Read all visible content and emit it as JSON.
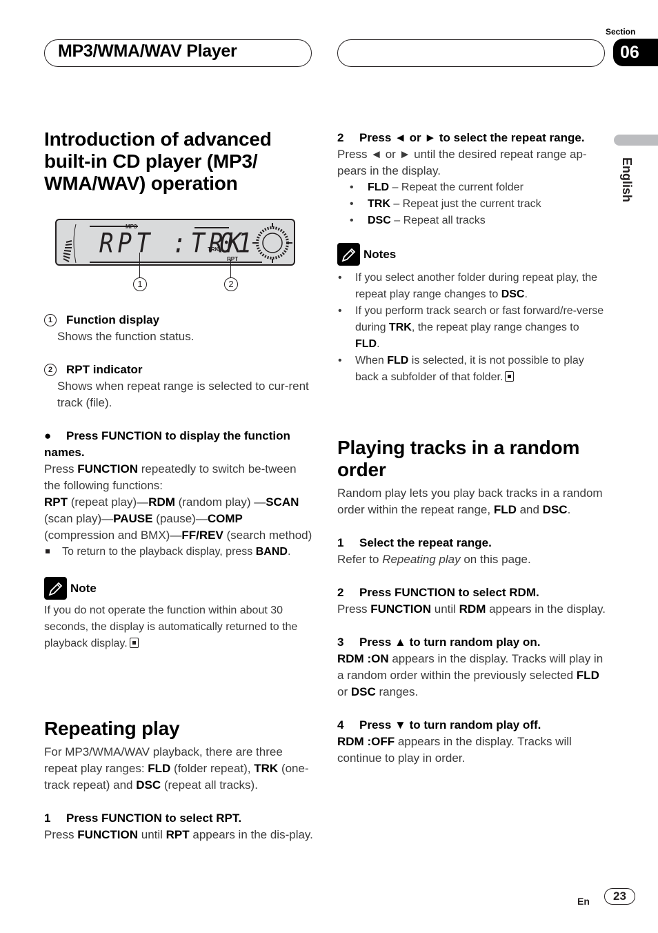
{
  "header": {
    "title": "MP3/WMA/WAV Player",
    "section_label": "Section",
    "section_number": "06",
    "language_tab": "English"
  },
  "left": {
    "intro_heading": "Introduction of advanced built-in CD player (MP3/ WMA/WAV) operation",
    "lcd": {
      "main_text": "RPT :TRK",
      "track_label": "TRK",
      "track_number": "01",
      "mp3_label": "MP3",
      "rpt_label": "RPT",
      "callouts": [
        "1",
        "2"
      ]
    },
    "legend": [
      {
        "num": "1",
        "title": "Function display",
        "desc": "Shows the function status."
      },
      {
        "num": "2",
        "title": "RPT indicator",
        "desc": "Shows when repeat range is selected to cur-rent track (file)."
      }
    ],
    "bullet_step": {
      "heading": "Press FUNCTION to display the function names.",
      "p1_pre": "Press ",
      "p1_bold": "FUNCTION",
      "p1_post": " repeatedly to switch be-tween the following functions:",
      "functions": [
        {
          "name": "RPT",
          "desc": " (repeat play)—"
        },
        {
          "name": "RDM",
          "desc": " (random play) —"
        },
        {
          "name": "SCAN",
          "desc": " (scan play)—"
        },
        {
          "name": "PAUSE",
          "desc": " (pause)—"
        },
        {
          "name": "COMP",
          "desc": " (compression and BMX)—"
        },
        {
          "name": "FF/REV",
          "desc": " (search method)"
        }
      ],
      "sub_pre": "To return to the playback display, press ",
      "sub_bold": "BAND",
      "sub_post": "."
    },
    "note": {
      "label": "Note",
      "text": "If you do not operate the function within about 30 seconds, the display is automatically returned to the playback display."
    },
    "repeat_heading": "Repeating play",
    "repeat_intro": {
      "a": "For MP3/WMA/WAV playback, there are three repeat play ranges: ",
      "b": "FLD",
      "c": " (folder repeat), ",
      "d": "TRK",
      "e": " (one-track repeat) and ",
      "f": "DSC",
      "g": " (repeat all tracks)."
    },
    "step1": {
      "num": "1",
      "heading": "Press FUNCTION to select RPT.",
      "a": "Press ",
      "b": "FUNCTION",
      "c": " until ",
      "d": "RPT",
      "e": " appears in the dis-play."
    }
  },
  "right": {
    "step2": {
      "num": "2",
      "heading": "Press ◄ or ► to select the repeat range.",
      "body": "Press ◄ or ► until the desired repeat range ap-pears in the display.",
      "options": [
        {
          "code": "FLD",
          "desc": " – Repeat the current folder"
        },
        {
          "code": "TRK",
          "desc": " – Repeat just the current track"
        },
        {
          "code": "DSC",
          "desc": " – Repeat all tracks"
        }
      ]
    },
    "notes": {
      "label": "Notes",
      "items": [
        {
          "a": "If you select another folder during repeat play, the repeat play range changes to ",
          "b": "DSC",
          "c": "."
        },
        {
          "a": "If you perform track search or fast forward/re-verse during ",
          "b": "TRK",
          "c": ", the repeat play range changes to ",
          "d": "FLD",
          "e": "."
        },
        {
          "a": "When ",
          "b": "FLD",
          "c": " is selected, it is not possible to play back a subfolder of that folder."
        }
      ]
    },
    "random_heading": "Playing tracks in a random order",
    "random_intro": {
      "a": "Random play lets you play back tracks in a random order within the repeat range, ",
      "b": "FLD",
      "c": " and ",
      "d": "DSC",
      "e": "."
    },
    "steps": [
      {
        "num": "1",
        "heading": "Select the repeat range.",
        "a": "Refer to ",
        "i": "Repeating play",
        "c": " on this page."
      },
      {
        "num": "2",
        "heading": "Press FUNCTION to select RDM.",
        "a": "Press ",
        "b": "FUNCTION",
        "c": " until ",
        "d": "RDM",
        "e": " appears in the display."
      },
      {
        "num": "3",
        "heading": "Press ▲ to turn random play on.",
        "b": "RDM :ON",
        "c": " appears in the display. Tracks will play in a random order within the previously selected ",
        "d": "FLD",
        "e": " or ",
        "f": "DSC",
        "g": " ranges."
      },
      {
        "num": "4",
        "heading": "Press ▼ to turn random play off.",
        "b": "RDM :OFF",
        "c": " appears in the display. Tracks will continue to play in order."
      }
    ]
  },
  "footer": {
    "lang": "En",
    "page": "23"
  }
}
